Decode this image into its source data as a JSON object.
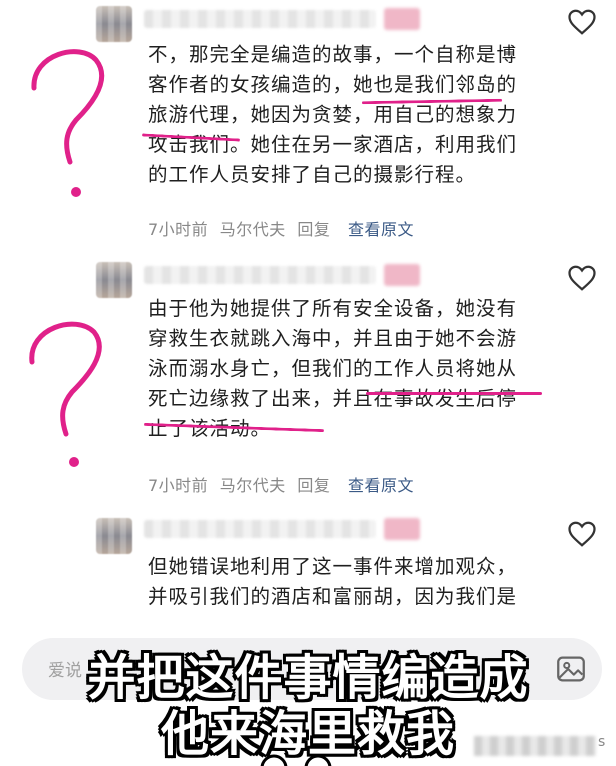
{
  "comments": [
    {
      "body_lines": [
        "不，那完全是编造的故事，一个自称是博",
        "客作者的女孩编造的，她也是我们邻岛的",
        "旅游代理，她因为贪婪，用自己的想象力",
        "攻击我们。她住在另一家酒店，利用我们",
        "的工作人员安排了自己的摄影行程。"
      ],
      "time": "7小时前",
      "location": "马尔代夫",
      "reply_label": "回复",
      "view_original_label": "查看原文"
    },
    {
      "body_lines": [
        "由于他为她提供了所有安全设备，她没有",
        "穿救生衣就跳入海中，并且由于她不会游",
        "泳而溺水身亡，但我们的工作人员将她从",
        "死亡边缘救了出来，并且在事故发生后停",
        "止了该活动。"
      ],
      "time": "7小时前",
      "location": "马尔代夫",
      "reply_label": "回复",
      "view_original_label": "查看原文"
    },
    {
      "body_lines": [
        "但她错误地利用了这一事件来增加观众，",
        "并吸引我们的酒店和富丽胡，因为我们是"
      ]
    }
  ],
  "input": {
    "placeholder": "爱说"
  },
  "caption": {
    "line1": "并把这件事情编造成",
    "line2": "他来海里救我"
  },
  "icons": {
    "like": "heart-outline-icon",
    "image": "image-icon"
  },
  "colors": {
    "annotation_pink": "#e0218a",
    "link_blue": "#3b5a86"
  }
}
